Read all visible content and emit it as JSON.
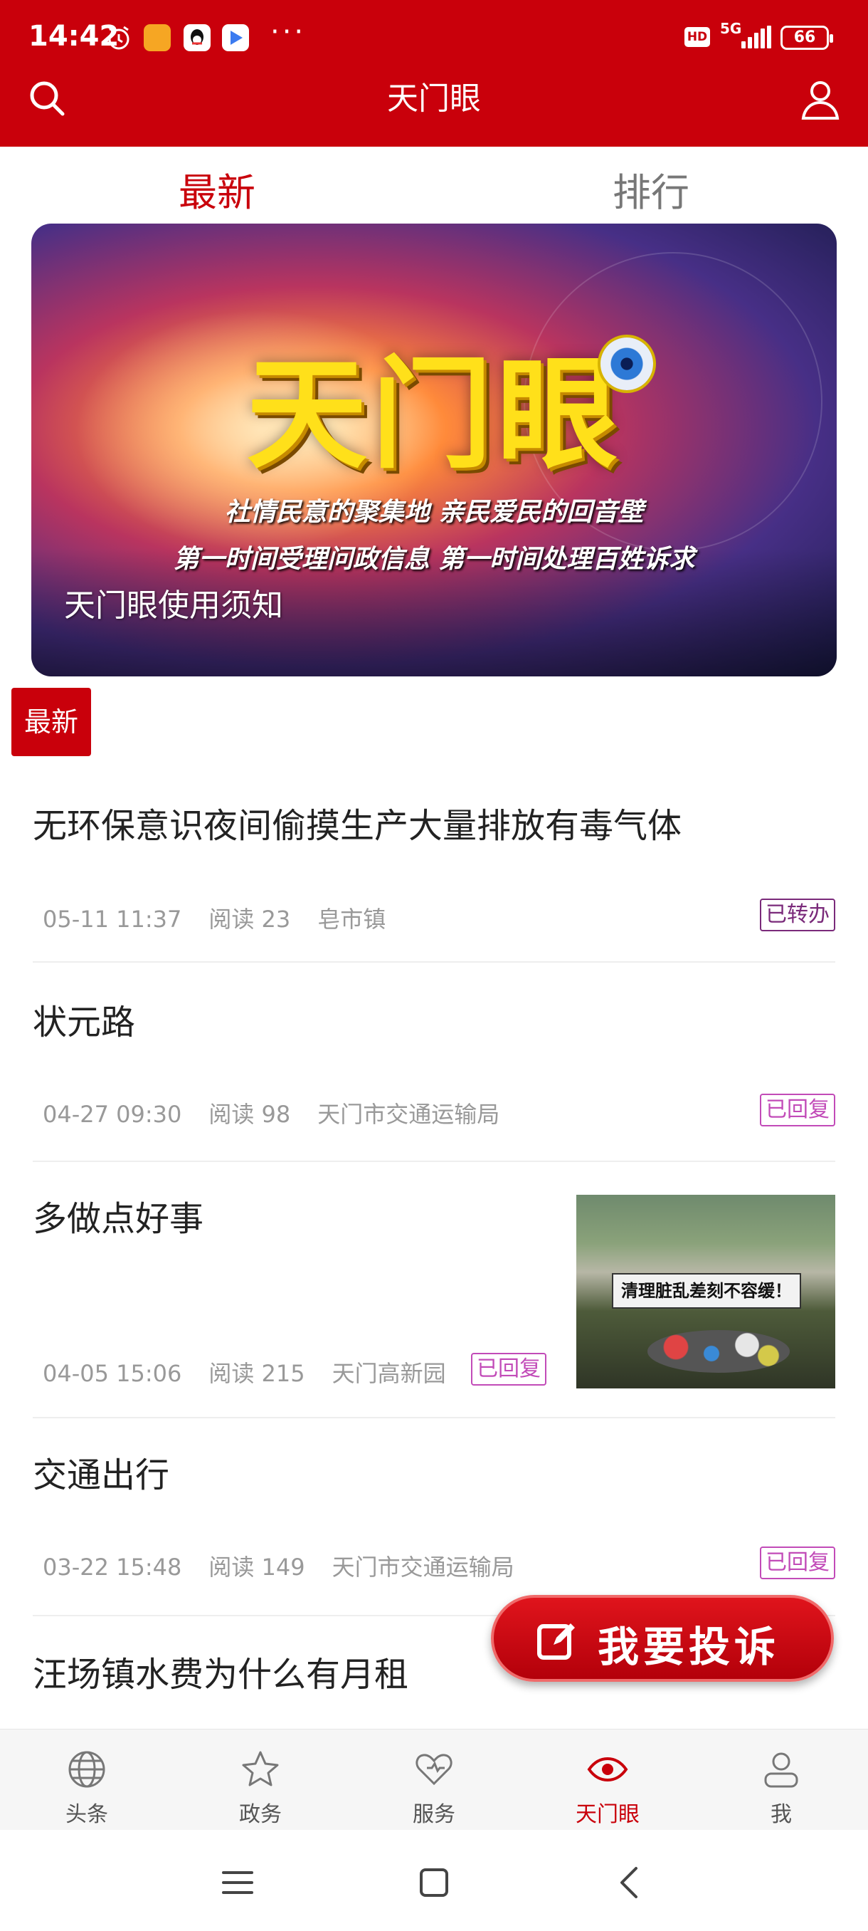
{
  "status_bar": {
    "time": "14:42",
    "hd": "HD",
    "network": "5G",
    "battery": "66",
    "more": "···"
  },
  "header": {
    "title": "天门眼",
    "search_icon": "search-icon",
    "user_icon": "user-icon"
  },
  "tabs": [
    {
      "label": "最新",
      "active": true
    },
    {
      "label": "排行",
      "active": false
    }
  ],
  "banner": {
    "logo_text": "天门眼",
    "subtitle_1": "社情民意的聚集地  亲民爱民的回音壁",
    "subtitle_2": "第一时间受理问政信息  第一时间处理百姓诉求",
    "caption": "天门眼使用须知"
  },
  "section_tag": "最新",
  "feed": [
    {
      "title": "无环保意识夜间偷摸生产大量排放有毒气体",
      "date": "05-11 11:37",
      "reads": "阅读 23",
      "source": "皂市镇",
      "status": "已转办",
      "status_type": "transfer"
    },
    {
      "title": "状元路",
      "date": "04-27 09:30",
      "reads": "阅读 98",
      "source": "天门市交通运输局",
      "status": "已回复",
      "status_type": "reply"
    },
    {
      "title": "多做点好事",
      "date": "04-05 15:06",
      "reads": "阅读 215",
      "source": "天门高新园",
      "status": "已回复",
      "status_type": "reply",
      "thumb_text": "清理脏乱差刻不容缓！"
    },
    {
      "title": "交通出行",
      "date": "03-22 15:48",
      "reads": "阅读 149",
      "source": "天门市交通运输局",
      "status": "已回复",
      "status_type": "reply"
    },
    {
      "title": "汪场镇水费为什么有月租"
    }
  ],
  "complain_button": "我要投诉",
  "bottom_nav": [
    {
      "label": "头条",
      "icon": "globe-icon",
      "active": false
    },
    {
      "label": "政务",
      "icon": "star-icon",
      "active": false
    },
    {
      "label": "服务",
      "icon": "heart-icon",
      "active": false
    },
    {
      "label": "天门眼",
      "icon": "eye-icon",
      "active": true
    },
    {
      "label": "我",
      "icon": "person-icon",
      "active": false
    }
  ],
  "colors": {
    "brand_red": "#c9000b",
    "transfer": "#7a2a7a",
    "reply": "#c24bb8"
  }
}
